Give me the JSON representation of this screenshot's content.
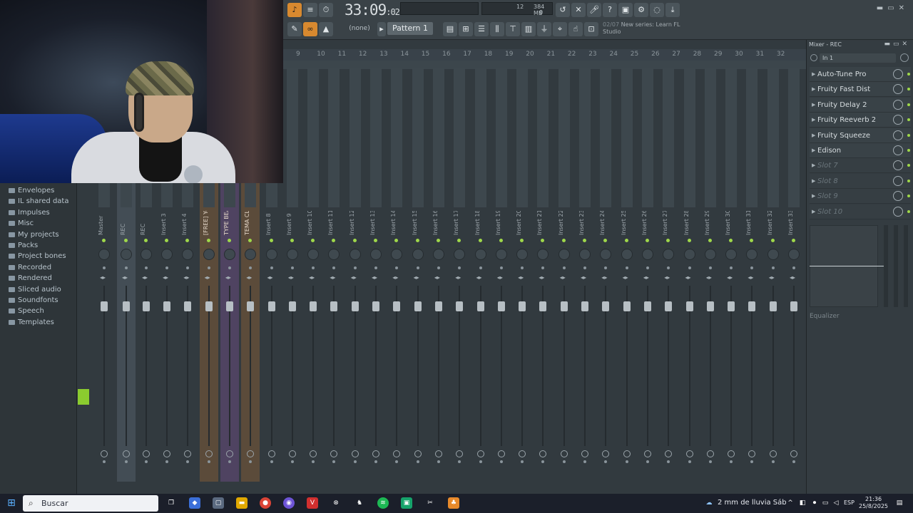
{
  "toolbar": {
    "time_main": "33:09",
    "time_sub": ":02",
    "cpu_value": "12",
    "memory": "384 MB",
    "mem_zero": "0",
    "none_label": "(none)",
    "pattern_label": "Pattern 1",
    "hint_counter": "02/07",
    "hint_text": "New series: Learn FL",
    "hint_text2": "Studio"
  },
  "browser": {
    "items": [
      "Envelopes",
      "IL shared data",
      "Impulses",
      "Misc",
      "My projects",
      "Packs",
      "Project bones",
      "Recorded",
      "Rendered",
      "Sliced audio",
      "Soundfonts",
      "Speech",
      "Templates"
    ]
  },
  "mixer": {
    "ruler": [
      "9",
      "10",
      "11",
      "12",
      "13",
      "14",
      "15",
      "16",
      "17",
      "18",
      "19",
      "20",
      "21",
      "22",
      "23",
      "24",
      "25",
      "26",
      "27",
      "28",
      "29",
      "30",
      "31",
      "32"
    ],
    "tracks": [
      "Master",
      "REC",
      "REC",
      "Insert 3",
      "Insert 4",
      "[FREE] Yo",
      "TYPE BEA",
      "TEMA CLA",
      "Insert 8",
      "Insert 9",
      "Insert 10",
      "Insert 11",
      "Insert 12",
      "Insert 13",
      "Insert 14",
      "Insert 15",
      "Insert 16",
      "Insert 17",
      "Insert 18",
      "Insert 19",
      "Insert 20",
      "Insert 21",
      "Insert 22",
      "Insert 23",
      "Insert 24",
      "Insert 25",
      "Insert 26",
      "Insert 27",
      "Insert 28",
      "Insert 29",
      "Insert 30",
      "Insert 31",
      "Insert 32",
      "Insert 33"
    ]
  },
  "mixer_panel": {
    "title": "Mixer - REC",
    "input": "In 1",
    "slots": [
      "Auto-Tune Pro",
      "Fruity Fast Dist",
      "Fruity Delay 2",
      "Fruity Reeverb 2",
      "Fruity Squeeze",
      "Edison",
      "Slot 7",
      "Slot 8",
      "Slot 9",
      "Slot 10"
    ],
    "eq_label": "Equalizer"
  },
  "taskbar": {
    "search_label": "Buscar",
    "weather": "2 mm de lluvia Sáb",
    "language": "ESP",
    "time": "21:36",
    "date": "25/8/2025"
  }
}
